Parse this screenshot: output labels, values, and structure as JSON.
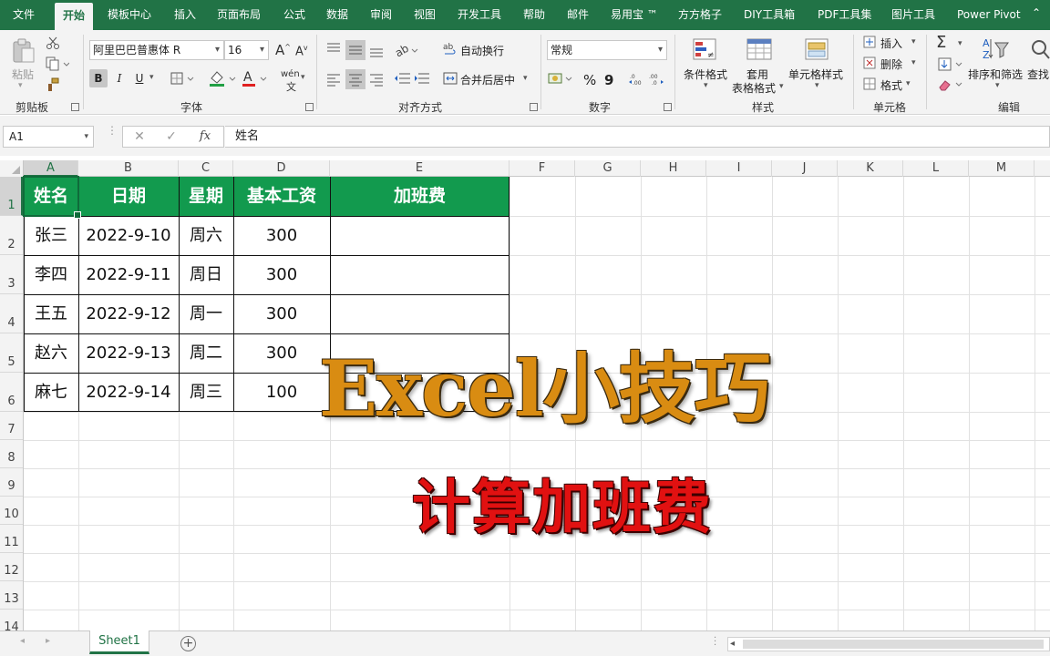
{
  "tabs": [
    "文件",
    "开始",
    "模板中心",
    "插入",
    "页面布局",
    "公式",
    "数据",
    "审阅",
    "视图",
    "开发工具",
    "帮助",
    "邮件",
    "易用宝 ™",
    "方方格子",
    "DIY工具箱",
    "PDF工具集",
    "图片工具",
    "Power Pivot"
  ],
  "ribbon": {
    "clipboard": {
      "paste": "粘贴",
      "label": "剪贴板"
    },
    "font": {
      "name": "阿里巴巴普惠体 R",
      "size": "16",
      "bold": "B",
      "italic": "I",
      "underline": "U",
      "grow": "A",
      "shrink": "A",
      "wen": "wén",
      "label": "字体"
    },
    "align": {
      "wrap": "自动换行",
      "merge": "合并后居中",
      "label": "对齐方式"
    },
    "number": {
      "format": "常规",
      "percent": "%",
      "comma": "9",
      "label": "数字"
    },
    "styles": {
      "cond": "条件格式",
      "table1": "套用",
      "table2": "表格格式",
      "cell": "单元格样式",
      "label": "样式"
    },
    "cells": {
      "insert": "插入",
      "delete": "删除",
      "format": "格式",
      "label": "单元格"
    },
    "edit": {
      "sort": "排序和筛选",
      "find": "查找",
      "label": "编辑"
    }
  },
  "formula_bar": {
    "cell_ref": "A1",
    "fx": "fx",
    "cancel": "✕",
    "confirm": "✓",
    "content": "姓名"
  },
  "columns": [
    "A",
    "B",
    "C",
    "D",
    "E",
    "F",
    "G",
    "H",
    "I",
    "J",
    "K",
    "L",
    "M"
  ],
  "rows": [
    "1",
    "2",
    "3",
    "4",
    "5",
    "6",
    "7",
    "8",
    "9",
    "10",
    "11",
    "12",
    "13",
    "14"
  ],
  "table": {
    "headers": [
      "姓名",
      "日期",
      "星期",
      "基本工资",
      "加班费"
    ],
    "rows": [
      [
        "张三",
        "2022-9-10",
        "周六",
        "300",
        ""
      ],
      [
        "李四",
        "2022-9-11",
        "周日",
        "300",
        ""
      ],
      [
        "王五",
        "2022-9-12",
        "周一",
        "300",
        ""
      ],
      [
        "赵六",
        "2022-9-13",
        "周二",
        "300",
        ""
      ],
      [
        "麻七",
        "2022-9-14",
        "周三",
        "100",
        ""
      ]
    ]
  },
  "overlay": {
    "title": "Excel小技巧",
    "subtitle": "计算加班费"
  },
  "sheet_tabs": [
    "Sheet1"
  ],
  "colors": {
    "excel_green": "#217346",
    "header_fill": "#129a4e",
    "title_orange": "#d98c12",
    "subtitle_red": "#e11111"
  }
}
